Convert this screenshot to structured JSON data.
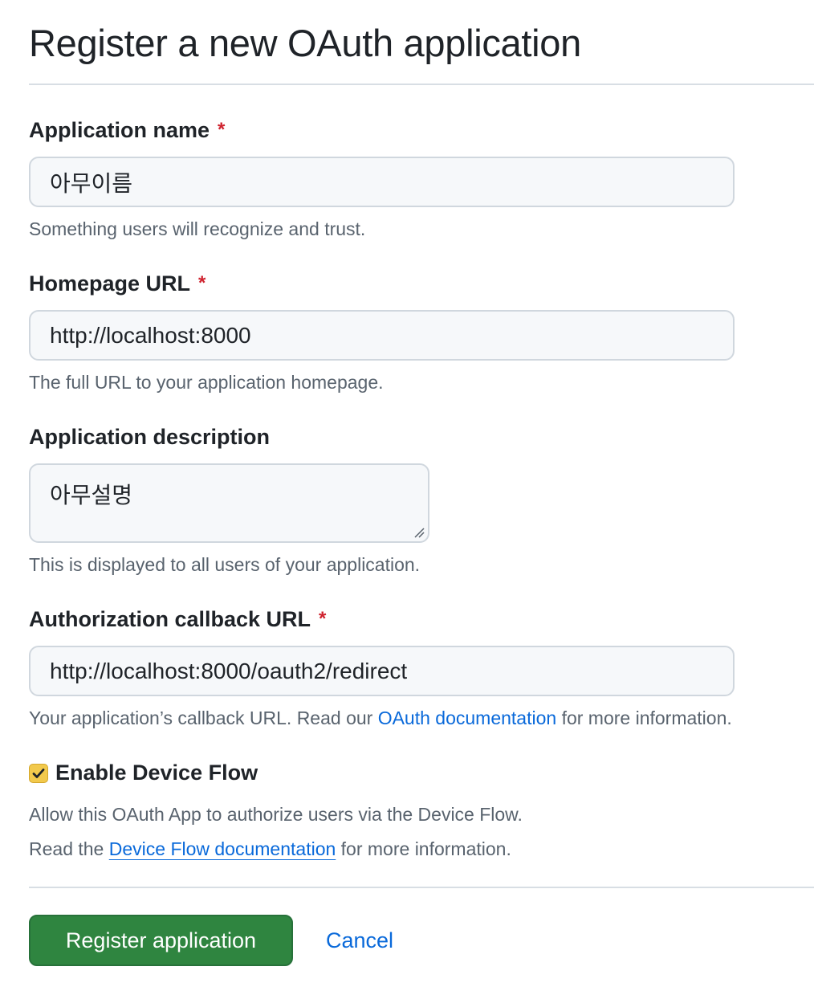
{
  "page": {
    "title": "Register a new OAuth application"
  },
  "fields": {
    "app_name": {
      "label": "Application name",
      "required_mark": "*",
      "value": "아무이름",
      "note": "Something users will recognize and trust."
    },
    "homepage_url": {
      "label": "Homepage URL",
      "required_mark": "*",
      "value": "http://localhost:8000",
      "note": "The full URL to your application homepage."
    },
    "description": {
      "label": "Application description",
      "value": "아무설명",
      "note": "This is displayed to all users of your application."
    },
    "callback_url": {
      "label": "Authorization callback URL",
      "required_mark": "*",
      "value": "http://localhost:8000/oauth2/redirect",
      "note_before": "Your application’s callback URL. Read our ",
      "note_link": "OAuth documentation",
      "note_after": " for more information."
    }
  },
  "device_flow": {
    "label": "Enable Device Flow",
    "checked": true,
    "note": "Allow this OAuth App to authorize users via the Device Flow.",
    "doc_before": "Read the ",
    "doc_link": "Device Flow documentation",
    "doc_after": " for more information."
  },
  "actions": {
    "register_label": "Register application",
    "cancel_label": "Cancel"
  },
  "colors": {
    "primary_button": "#2f8540",
    "link": "#0969da",
    "required": "#cf222e",
    "checkbox": "#f2c94c"
  }
}
